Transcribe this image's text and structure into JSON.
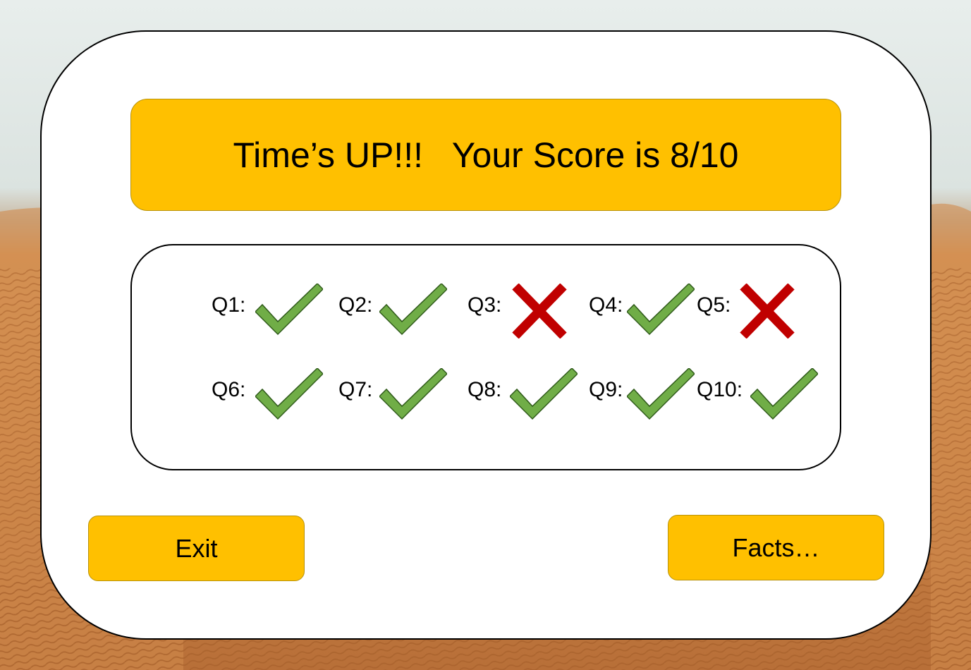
{
  "banner": {
    "message": "Time’s UP!!!   Your Score is 8/10"
  },
  "results": [
    {
      "label": "Q1:",
      "correct": true
    },
    {
      "label": "Q2:",
      "correct": true
    },
    {
      "label": "Q3:",
      "correct": false
    },
    {
      "label": "Q4:",
      "correct": true
    },
    {
      "label": "Q5:",
      "correct": false
    },
    {
      "label": "Q6:",
      "correct": true
    },
    {
      "label": "Q7:",
      "correct": true
    },
    {
      "label": "Q8:",
      "correct": true
    },
    {
      "label": "Q9:",
      "correct": true
    },
    {
      "label": "Q10:",
      "correct": true
    }
  ],
  "buttons": {
    "exit_label": "Exit",
    "facts_label": "Facts…"
  },
  "colors": {
    "accent": "#FFC000",
    "check": "#70AD47",
    "cross": "#C00000"
  },
  "icons": {
    "correct": "check-icon",
    "incorrect": "cross-icon"
  }
}
